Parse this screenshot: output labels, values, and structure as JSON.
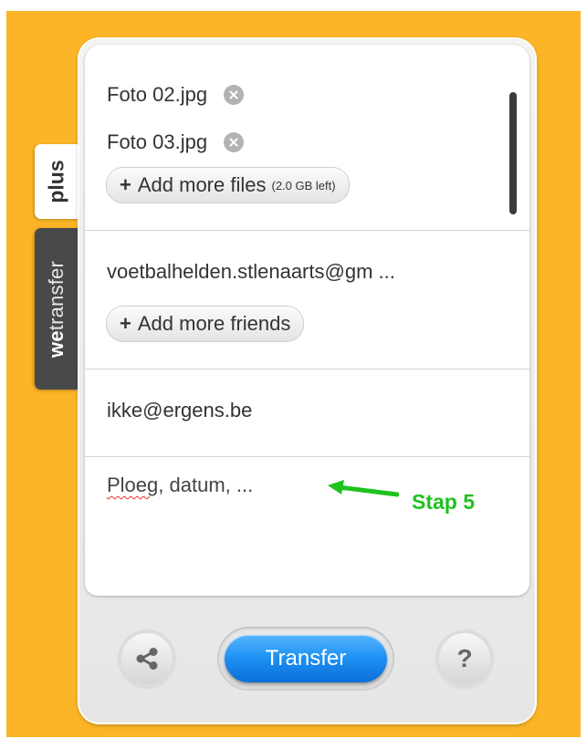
{
  "tabs": {
    "plus": "plus",
    "brand_bold": "we",
    "brand_rest": "transfer"
  },
  "files": {
    "items": [
      {
        "name": "Foto 02.jpg"
      },
      {
        "name": "Foto 03.jpg"
      }
    ],
    "add_more_label": "Add more files",
    "space_left": "(2.0 GB left)"
  },
  "friends": {
    "email": "voetbalhelden.stlenaarts@gm ...",
    "add_more_label": "Add more friends"
  },
  "sender": {
    "email": "ikke@ergens.be"
  },
  "message": {
    "text_first_word": "Ploeg",
    "text_rest": ", datum, ..."
  },
  "annotation": {
    "label": "Stap 5",
    "color": "#1fc21f"
  },
  "buttons": {
    "transfer_label": "Transfer",
    "help_label": "?"
  },
  "colors": {
    "background": "#fbb526",
    "transfer_blue": "#1c8ff2",
    "side_tab_dark": "#48494b"
  },
  "icons": {
    "share": "share-icon",
    "remove": "remove-circle-icon",
    "help": "help-icon"
  }
}
